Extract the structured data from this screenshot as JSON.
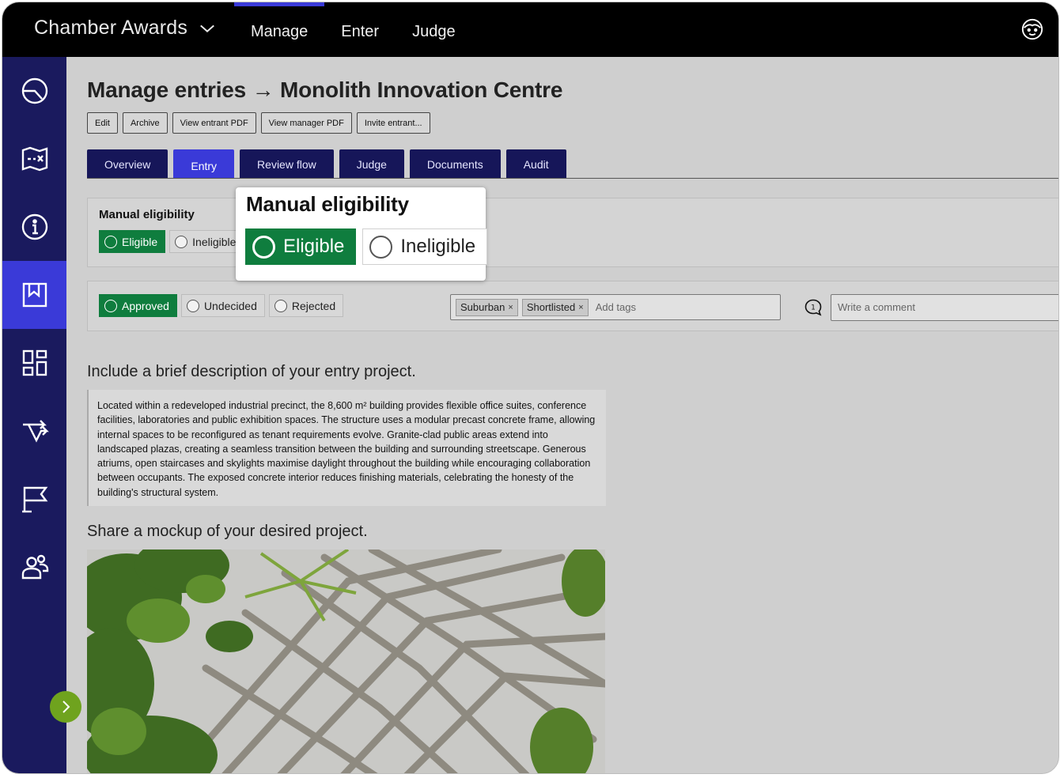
{
  "app": {
    "name": "Chamber Awards",
    "nav": [
      "Manage",
      "Enter",
      "Judge"
    ],
    "active_nav": 0
  },
  "sidebar": {
    "icons": [
      "dashboard-gauge-icon",
      "map-icon",
      "info-icon",
      "bookmark-icon",
      "layout-grid-icon",
      "flow-arrows-icon",
      "flag-icon",
      "users-icon"
    ],
    "active_index": 3
  },
  "page": {
    "title": "Manage entries → Monolith Innovation Centre",
    "actions": [
      "Edit",
      "Archive",
      "View entrant PDF",
      "View manager PDF",
      "Invite entrant..."
    ],
    "tabs": [
      "Overview",
      "Entry",
      "Review flow",
      "Judge",
      "Documents",
      "Audit"
    ],
    "active_tab": 1
  },
  "eligibility": {
    "title": "Manual eligibility",
    "options": [
      "Eligible",
      "Ineligible"
    ],
    "selected": 0
  },
  "review": {
    "options": [
      "Approved",
      "Undecided",
      "Rejected"
    ],
    "selected": 0,
    "tags": [
      "Suburban",
      "Shortlisted"
    ],
    "tag_remove": "×",
    "tag_placeholder": "Add tags",
    "comment_count": "1",
    "comment_placeholder": "Write a comment"
  },
  "entry": {
    "question_1": "Include a brief description of your entry project.",
    "answer_1": "Located within a redeveloped industrial precinct, the 8,600 m² building provides flexible office suites, conference facilities, laboratories and public exhibition spaces. The structure uses a modular precast concrete frame, allowing internal spaces to be reconfigured as tenant requirements evolve. Granite-clad public areas extend into landscaped plazas, creating a seamless transition between the building and surrounding streetscape. Generous atriums, open staircases and skylights maximise daylight throughout the building while encouraging collaboration between occupants. The exposed concrete interior reduces finishing materials, celebrating the honesty of the building's structural system.",
    "question_2": "Share a mockup of your desired project."
  },
  "callout": {
    "title": "Manual eligibility",
    "options": [
      "Eligible",
      "Ineligible"
    ],
    "selected": 0
  },
  "colors": {
    "topbar": "#000000",
    "sidebar": "#1a1a5e",
    "accent": "#3a3ad8",
    "tab": "#161659",
    "selected_green": "#0f7d3e",
    "expand_button": "#6fa31e"
  }
}
